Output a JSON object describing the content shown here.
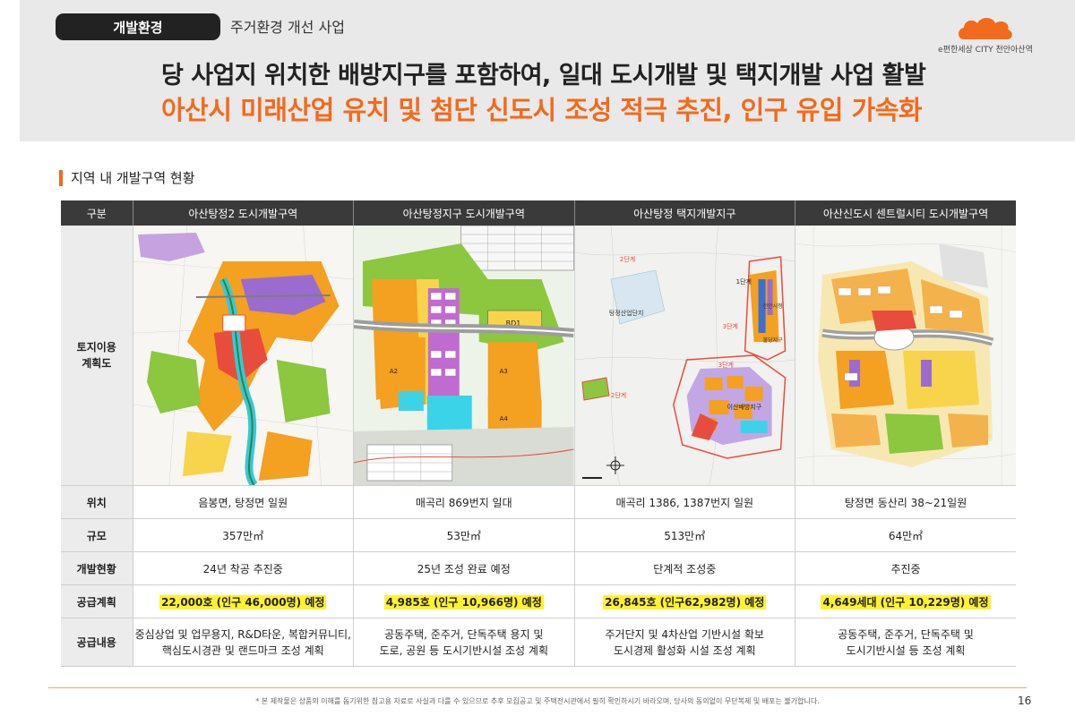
{
  "header": {
    "tag": "개발환경",
    "subtitle": "주거환경 개선 사업",
    "logo_text": "e편한세상 CITY 천안아산역",
    "headline_1": "당 사업지 위치한 배방지구를 포함하여, 일대 도시개발 및 택지개발 사업 활발",
    "headline_2": "아산시 미래산업 유치 및 첨단 신도시 조성 적극 추진, 인구 유입 가속화",
    "accent_color": "#f26a1b"
  },
  "section": {
    "title": "지역 내 개발구역 현황"
  },
  "table": {
    "corner": "구분",
    "columns": [
      "아산탕정2 도시개발구역",
      "아산탕정지구 도시개발구역",
      "아산탕정 택지개발지구",
      "아산신도시 센트럴시티 도시개발구역"
    ],
    "map_row_label": "토지이용\n계획도",
    "maps": [
      {
        "icon": "land-use-map-1"
      },
      {
        "icon": "land-use-map-2",
        "labels": [
          "BD1",
          "A2",
          "A3",
          "A4"
        ]
      },
      {
        "icon": "land-use-map-3",
        "labels": [
          "2단계",
          "탕정산업단지",
          "1단계",
          "3단계",
          "2단계",
          "3단계",
          "이산배방지구",
          "불당지구",
          "천안시청"
        ]
      },
      {
        "icon": "land-use-map-4"
      }
    ],
    "rows": [
      {
        "label": "위치",
        "values": [
          "음봉면, 탕정면 일원",
          "매곡리 869번지 일대",
          "매곡리 1386, 1387번지 일원",
          "탕정면 동산리 38~21일원"
        ]
      },
      {
        "label": "규모",
        "values": [
          "357만㎡",
          "53만㎡",
          "513만㎡",
          "64만㎡"
        ]
      },
      {
        "label": "개발현황",
        "values": [
          "24년 착공 추진중",
          "25년 조성 완료 예정",
          "단계적 조성중",
          "추진중"
        ]
      },
      {
        "label": "공급계획",
        "values": [
          "22,000호 (인구 46,000명) 예정",
          "4,985호 (인구 10,966명) 예정",
          "26,845호 (인구62,982명) 예정",
          "4,649세대 (인구 10,229명) 예정"
        ]
      },
      {
        "label": "공급내용",
        "values": [
          [
            "중심상업 및 업무용지, R&D타운, 복합커뮤니티,",
            "핵심도시경관 및 랜드마크 조성 계획"
          ],
          [
            "공동주택, 준주거, 단독주택 용지 및",
            "도로, 공원 등 도시기반시설 조성 계획"
          ],
          [
            "주거단지 및 4차산업 기반시설 확보",
            "도시경제 활성화 시설 조성 계획"
          ],
          [
            "공동주택, 준주거, 단독주택 및",
            "도시기반시설 등 조성 계획"
          ]
        ]
      }
    ]
  },
  "footer": {
    "note": "* 본 제작물은 상품의 이해를 돕기위한 참고용 자료로 사실과 다를 수 있으므로 추후 모집공고 및 주택전시관에서 필히 확인하시기 바라오며, 당사의 동의없이 무단복제 및 배포는 불가합니다.",
    "page": "16"
  }
}
